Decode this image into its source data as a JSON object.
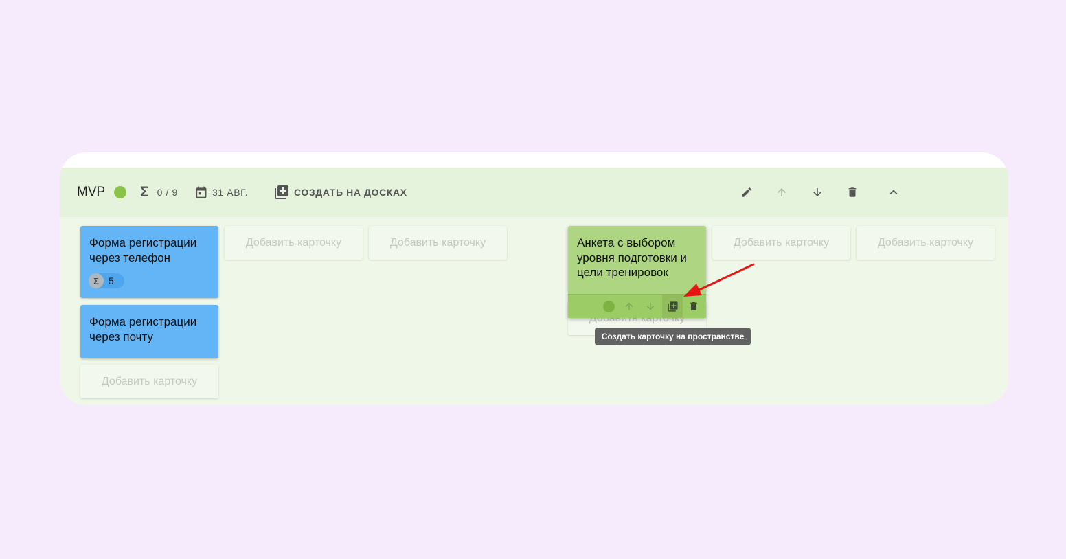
{
  "colors": {
    "page_background": "#f5ebfc",
    "status_green": "#8bc34a",
    "card_blue": "#64b5f6",
    "card_green": "#aed581",
    "annotation_arrow": "#e81414"
  },
  "header": {
    "title": "MVP",
    "status_icon": "green-dot",
    "progress_icon": "sigma-icon",
    "progress": "0 / 9",
    "date_icon": "calendar-icon",
    "date": "31 АВГ.",
    "create_icon": "library-add-icon",
    "create_label": "СОЗДАТЬ НА ДОСКАХ",
    "actions": [
      "edit-icon",
      "arrow-up-icon",
      "arrow-down-icon",
      "delete-icon",
      "chevron-up-icon"
    ]
  },
  "board": {
    "card_phone": {
      "title": "Форма регистрации через телефон",
      "badge_icon": "sigma-icon",
      "badge_value": "5"
    },
    "card_email": {
      "title": "Форма регистрации через почту"
    },
    "card_survey": {
      "title": "Анкета с выбором уровня подготовки и цели тренировок",
      "toolbar": [
        "status-dot",
        "arrow-up-icon",
        "arrow-down-icon",
        "library-add-icon",
        "delete-icon"
      ]
    },
    "add_card_label": "Добавить карточку"
  },
  "tooltip": {
    "text": "Создать карточку на пространстве"
  }
}
